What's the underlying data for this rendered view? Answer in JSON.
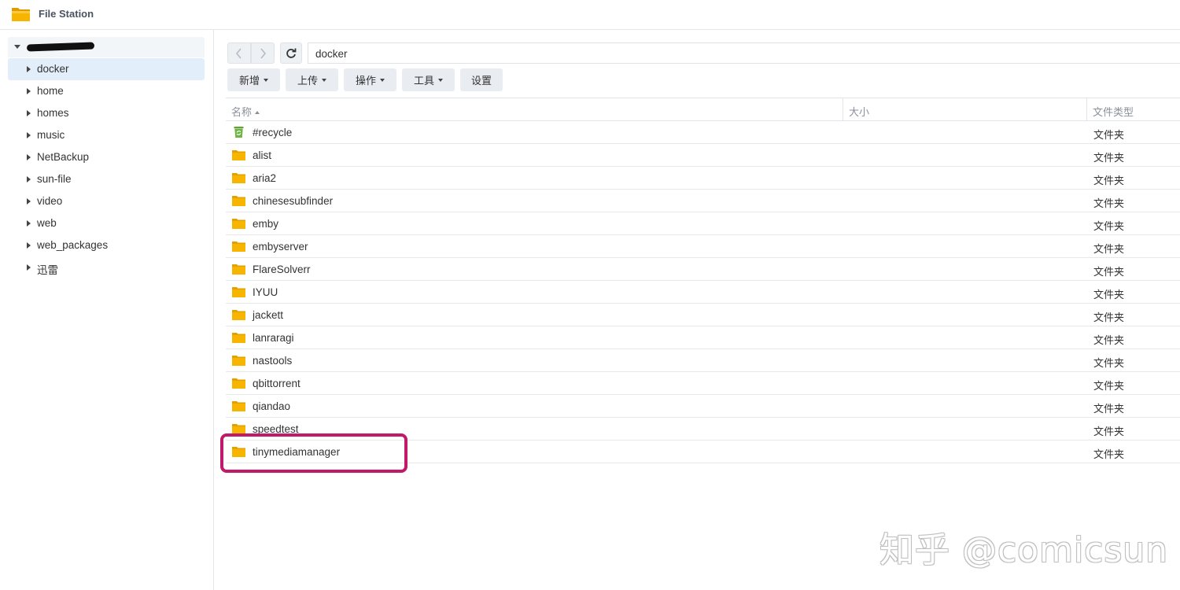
{
  "app": {
    "title": "File Station",
    "icon": "folder-app-icon"
  },
  "sidebar": {
    "root": {
      "label_redacted": true
    },
    "items": [
      {
        "label": "docker",
        "active": true
      },
      {
        "label": "home"
      },
      {
        "label": "homes"
      },
      {
        "label": "music"
      },
      {
        "label": "NetBackup"
      },
      {
        "label": "sun-file"
      },
      {
        "label": "video"
      },
      {
        "label": "web"
      },
      {
        "label": "web_packages"
      },
      {
        "label": "迅雷"
      }
    ]
  },
  "navigation": {
    "back_icon": "chevron-left-icon",
    "forward_icon": "chevron-right-icon",
    "refresh_icon": "refresh-icon",
    "path": "docker"
  },
  "toolbar": {
    "buttons": [
      {
        "label": "新增",
        "dropdown": true
      },
      {
        "label": "上传",
        "dropdown": true
      },
      {
        "label": "操作",
        "dropdown": true
      },
      {
        "label": "工具",
        "dropdown": true
      },
      {
        "label": "设置",
        "dropdown": false
      }
    ]
  },
  "table": {
    "columns": {
      "name": "名称",
      "size": "大小",
      "type": "文件类型"
    },
    "rows": [
      {
        "name": "#recycle",
        "type": "文件夹",
        "icon": "recycle-bin-icon"
      },
      {
        "name": "alist",
        "type": "文件夹",
        "icon": "folder-icon"
      },
      {
        "name": "aria2",
        "type": "文件夹",
        "icon": "folder-icon"
      },
      {
        "name": "chinesesubfinder",
        "type": "文件夹",
        "icon": "folder-icon"
      },
      {
        "name": "emby",
        "type": "文件夹",
        "icon": "folder-icon"
      },
      {
        "name": "embyserver",
        "type": "文件夹",
        "icon": "folder-icon"
      },
      {
        "name": "FlareSolverr",
        "type": "文件夹",
        "icon": "folder-icon"
      },
      {
        "name": "IYUU",
        "type": "文件夹",
        "icon": "folder-icon"
      },
      {
        "name": "jackett",
        "type": "文件夹",
        "icon": "folder-icon"
      },
      {
        "name": "lanraragi",
        "type": "文件夹",
        "icon": "folder-icon"
      },
      {
        "name": "nastools",
        "type": "文件夹",
        "icon": "folder-icon"
      },
      {
        "name": "qbittorrent",
        "type": "文件夹",
        "icon": "folder-icon"
      },
      {
        "name": "qiandao",
        "type": "文件夹",
        "icon": "folder-icon"
      },
      {
        "name": "speedtest",
        "type": "文件夹",
        "icon": "folder-icon"
      },
      {
        "name": "tinymediamanager",
        "type": "文件夹",
        "icon": "folder-icon",
        "highlighted": true
      }
    ]
  },
  "colors": {
    "accent_highlight": "#c11a6b",
    "folder": "#f5b700",
    "recycle": "#6fb440",
    "active_bg": "#e2eef9"
  },
  "watermark": "知乎 @comicsun"
}
